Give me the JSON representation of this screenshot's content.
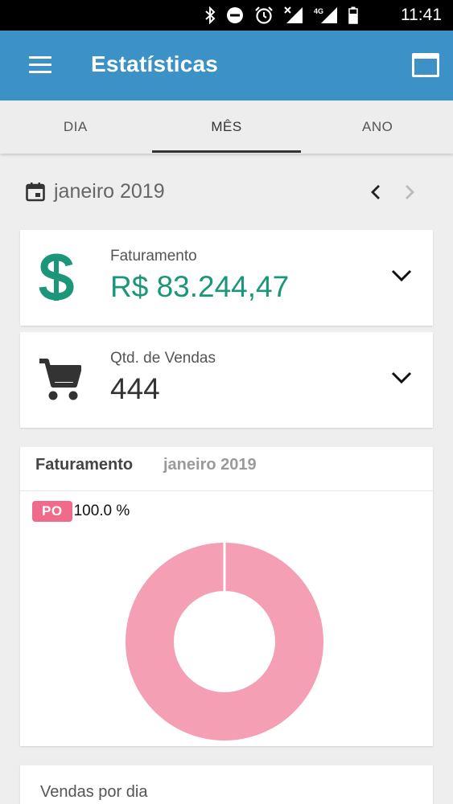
{
  "status_bar": {
    "time": "11:41",
    "network": "4G",
    "icons": [
      "bluetooth-icon",
      "do-not-disturb-icon",
      "alarm-icon",
      "signal-off-icon",
      "signal-4g-icon",
      "battery-icon"
    ]
  },
  "app_bar": {
    "title": "Estatísticas",
    "menu_icon": "hamburger-menu-icon",
    "action_icon": "window-icon",
    "color": "#3c92c6"
  },
  "tabs": [
    {
      "label": "DIA",
      "active": false
    },
    {
      "label": "MÊS",
      "active": true
    },
    {
      "label": "ANO",
      "active": false
    }
  ],
  "period": {
    "label": "janeiro 2019",
    "icon": "calendar-icon"
  },
  "summary_cards": [
    {
      "label": "Faturamento",
      "value": "R$ 83.244,47",
      "icon": "dollar-icon",
      "color": "#1c9679"
    },
    {
      "label": "Qtd. de Vendas",
      "value": "444",
      "icon": "shopping-cart-icon",
      "color": "#333333"
    }
  ],
  "chart": {
    "title": "Faturamento",
    "subtitle": "janeiro 2019"
  },
  "chart_data": {
    "type": "pie",
    "categories": [
      "PO"
    ],
    "values": [
      100.0
    ],
    "labels": [
      "100.0 %"
    ],
    "colors": [
      "#f49fb3"
    ],
    "legend_color": "#f06b8a",
    "donut": true
  },
  "bottom_card": {
    "title": "Vendas por dia"
  }
}
